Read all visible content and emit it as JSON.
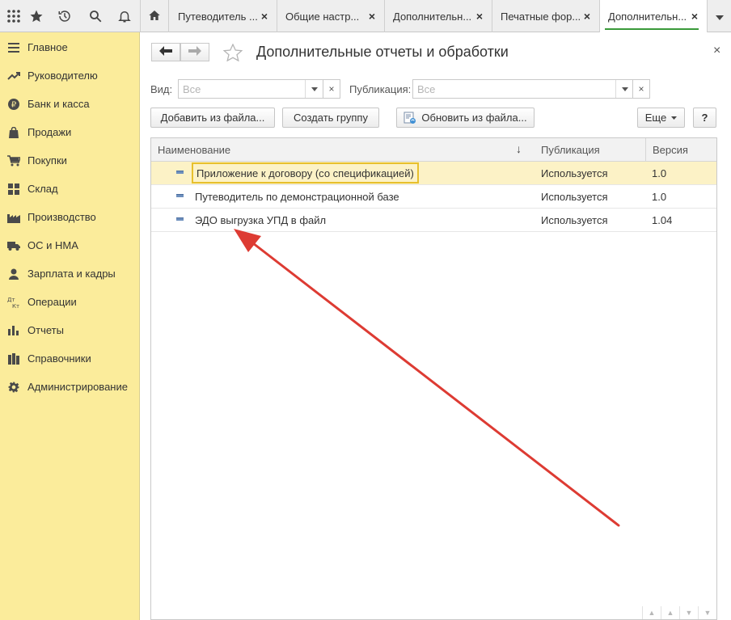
{
  "window": {
    "accent": "#3a9a3a"
  },
  "toolbar": {
    "icons": [
      "apps-grid-icon",
      "star-icon",
      "history-icon",
      "search-icon",
      "bell-icon"
    ]
  },
  "tabs": {
    "home_icon": "home-icon",
    "items": [
      {
        "label": "Путеводитель ...",
        "active": false
      },
      {
        "label": "Общие настр...",
        "active": false
      },
      {
        "label": "Дополнительн...",
        "active": false
      },
      {
        "label": "Печатные фор...",
        "active": false
      },
      {
        "label": "Дополнительн...",
        "active": true
      }
    ],
    "close_label": "×"
  },
  "sidebar": {
    "background": "#fbec9b",
    "items": [
      {
        "label": "Главное",
        "icon": "menu-lines-icon"
      },
      {
        "label": "Руководителю",
        "icon": "trend-icon"
      },
      {
        "label": "Банк и касса",
        "icon": "ruble-icon"
      },
      {
        "label": "Продажи",
        "icon": "shopping-bag-icon"
      },
      {
        "label": "Покупки",
        "icon": "cart-icon"
      },
      {
        "label": "Склад",
        "icon": "warehouse-icon"
      },
      {
        "label": "Производство",
        "icon": "factory-icon"
      },
      {
        "label": "ОС и НМА",
        "icon": "truck-icon"
      },
      {
        "label": "Зарплата и кадры",
        "icon": "person-icon"
      },
      {
        "label": "Операции",
        "icon": "dt-kt-icon"
      },
      {
        "label": "Отчеты",
        "icon": "bar-chart-icon"
      },
      {
        "label": "Справочники",
        "icon": "books-icon"
      },
      {
        "label": "Администрирование",
        "icon": "gear-icon"
      }
    ]
  },
  "form": {
    "title": "Дополнительные отчеты и обработки",
    "close": "×",
    "filters": {
      "kind_label": "Вид:",
      "kind_placeholder": "Все",
      "publication_label": "Публикация:",
      "publication_placeholder": "Все",
      "clear": "×"
    },
    "buttons": {
      "add_from_file": "Добавить из файла...",
      "create_group": "Создать группу",
      "update_from_file": "Обновить из файла...",
      "more": "Еще",
      "help": "?"
    },
    "table": {
      "columns": [
        "Наименование",
        "Публикация",
        "Версия"
      ],
      "sort_indicator": "↓",
      "rows": [
        {
          "name": "Приложение к договору (со спецификацией)",
          "publication": "Используется",
          "version": "1.0",
          "selected": true
        },
        {
          "name": "Путеводитель по демонстрационной базе",
          "publication": "Используется",
          "version": "1.0",
          "selected": false
        },
        {
          "name": "ЭДО выгрузка УПД в файл",
          "publication": "Используется",
          "version": "1.04",
          "selected": false
        }
      ]
    }
  },
  "annotation": {
    "type": "red-arrow",
    "color": "#dd3b33",
    "points_to": "ЭДО выгрузка УПД в файл"
  },
  "colors": {
    "selected_row": "#fcf2c6",
    "selection_border": "#e7c02d",
    "row_marker": "#6d8fbd"
  }
}
